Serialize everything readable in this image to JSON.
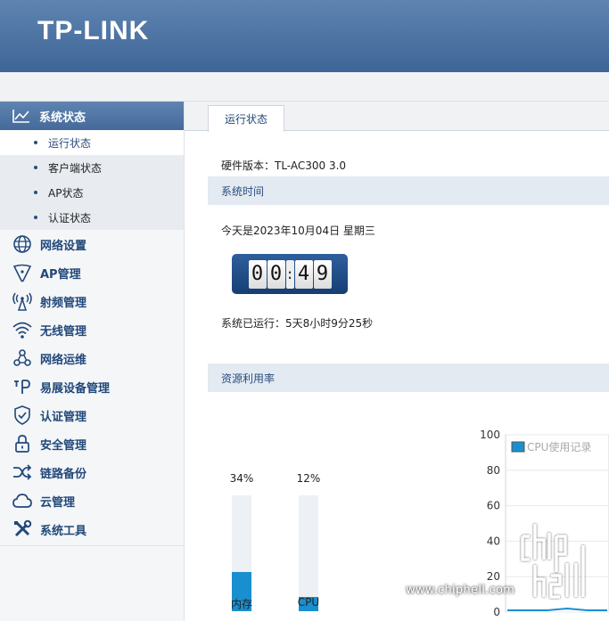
{
  "header": {
    "logo": "TP-LINK"
  },
  "sidebar": {
    "active_group": "系统状态",
    "sub_items": [
      {
        "label": "运行状态",
        "active": true
      },
      {
        "label": "客户端状态",
        "active": false
      },
      {
        "label": "AP状态",
        "active": false
      },
      {
        "label": "认证状态",
        "active": false
      }
    ],
    "items": [
      {
        "label": "网络设置",
        "icon": "globe-icon"
      },
      {
        "label": "AP管理",
        "icon": "ap-icon"
      },
      {
        "label": "射频管理",
        "icon": "antenna-icon"
      },
      {
        "label": "无线管理",
        "icon": "wifi-icon"
      },
      {
        "label": "网络运维",
        "icon": "network-nodes-icon"
      },
      {
        "label": "易展设备管理",
        "icon": "easy-mesh-icon"
      },
      {
        "label": "认证管理",
        "icon": "shield-check-icon"
      },
      {
        "label": "安全管理",
        "icon": "lock-icon"
      },
      {
        "label": "链路备份",
        "icon": "shuffle-icon"
      },
      {
        "label": "云管理",
        "icon": "cloud-icon"
      },
      {
        "label": "系统工具",
        "icon": "tools-icon"
      }
    ]
  },
  "main": {
    "tab": "运行状态",
    "hardware_version": "硬件版本：TL-AC300 3.0",
    "system_time_title": "系统时间",
    "date_text": "今天是2023年10月04日 星期三",
    "clock": {
      "d1": "0",
      "d2": "0",
      "sep": ":",
      "d3": "4",
      "d4": "9"
    },
    "uptime": "系统已运行：5天8小时9分25秒",
    "resource_title": "资源利用率",
    "memory": {
      "label": "内存",
      "percent_text": "34%",
      "value": 34
    },
    "cpu": {
      "label": "CPU",
      "percent_text": "12%",
      "value": 12
    }
  },
  "chart_data": {
    "type": "line",
    "legend": "CPU使用记录",
    "legend_placement": "top-left",
    "series": [
      {
        "name": "CPU使用记录",
        "values": [
          1,
          1,
          1,
          2,
          1,
          1
        ]
      }
    ],
    "yticks": [
      "100",
      "80",
      "60",
      "40",
      "20",
      "0"
    ],
    "ylim": [
      0,
      100
    ],
    "grid": true,
    "colors": {
      "line": "#1a8fcf",
      "legend_box": "#1a8fcf"
    }
  },
  "watermark": {
    "text": "www.chiphell.com"
  }
}
